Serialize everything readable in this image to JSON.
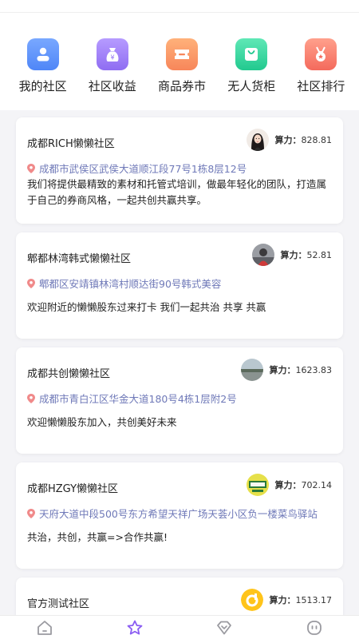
{
  "nav": [
    {
      "label": "我的社区",
      "icon": "user-icon"
    },
    {
      "label": "社区收益",
      "icon": "money-bag-icon"
    },
    {
      "label": "商品券市",
      "icon": "coupon-icon"
    },
    {
      "label": "无人货柜",
      "icon": "shopping-bag-icon"
    },
    {
      "label": "社区排行",
      "icon": "medal-icon"
    }
  ],
  "power_label": "算力：",
  "communities": [
    {
      "name": "成都RICH懒懒社区",
      "power": "828.81",
      "address": "成都市武侯区武侯大道顺江段77号1栋8层12号",
      "description": "我们将提供最精致的素材和托管式培训，做最年轻化的团队，打造属于自己的券商风格，一起共创共赢共享。",
      "avatar": "woman-portrait-avatar"
    },
    {
      "name": "郫都林湾韩式懒懒社区",
      "power": "52.81",
      "address": "郫都区安靖镇林湾村顺达街90号韩式美容",
      "description": "欢迎附近的懒懒股东过来打卡 我们一起共治 共享 共赢",
      "avatar": "person-avatar"
    },
    {
      "name": "成都共创懒懒社区",
      "power": "1623.83",
      "address": "成都市青白江区华金大道180号4栋1层附2号",
      "description": "欢迎懒懒股东加入，共创美好未来",
      "avatar": "landscape-avatar"
    },
    {
      "name": "成都HZGY懒懒社区",
      "power": "702.14",
      "address": "天府大道中段500号东方希望天祥广场天荟小区负一楼菜鸟驿站",
      "description": "共治，共创，共赢=>合作共赢!",
      "avatar": "logo-avatar"
    },
    {
      "name": "官方测试社区",
      "power": "1513.17",
      "address": "",
      "description": "",
      "avatar": "yellow-logo-avatar"
    }
  ],
  "tabs": [
    {
      "name": "home",
      "active": false
    },
    {
      "name": "community",
      "active": true
    },
    {
      "name": "diamond",
      "active": false
    },
    {
      "name": "profile",
      "active": false
    }
  ],
  "colors": {
    "accent": "#8a5cf2",
    "address": "#6f79b8",
    "pin": "#f08a8a"
  }
}
